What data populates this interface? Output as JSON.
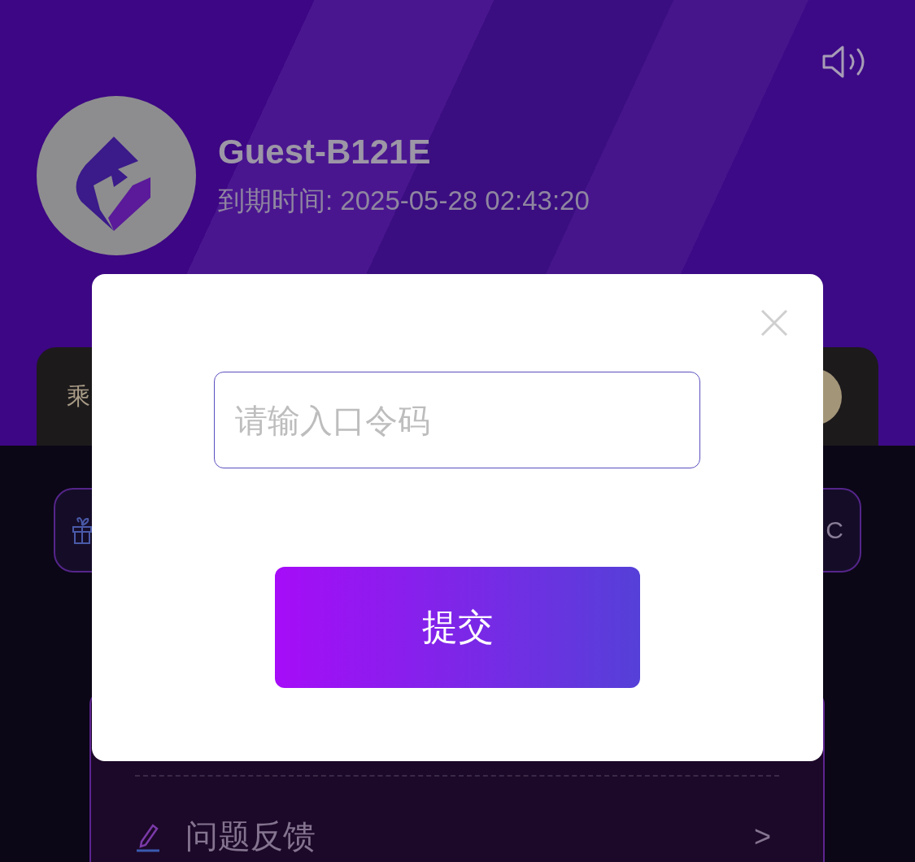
{
  "profile": {
    "username": "Guest-B121E",
    "expiry": "到期时间: 2025-05-28 02:43:20"
  },
  "card": {
    "label": "乘"
  },
  "quick_buttons": [
    {
      "kind": "icon"
    },
    {
      "kind": "text",
      "label": "C"
    }
  ],
  "menu": [
    {
      "label": "问题反馈",
      "arrow": ">"
    }
  ],
  "dialog": {
    "placeholder": "请输入口令码",
    "submit": "提交"
  }
}
